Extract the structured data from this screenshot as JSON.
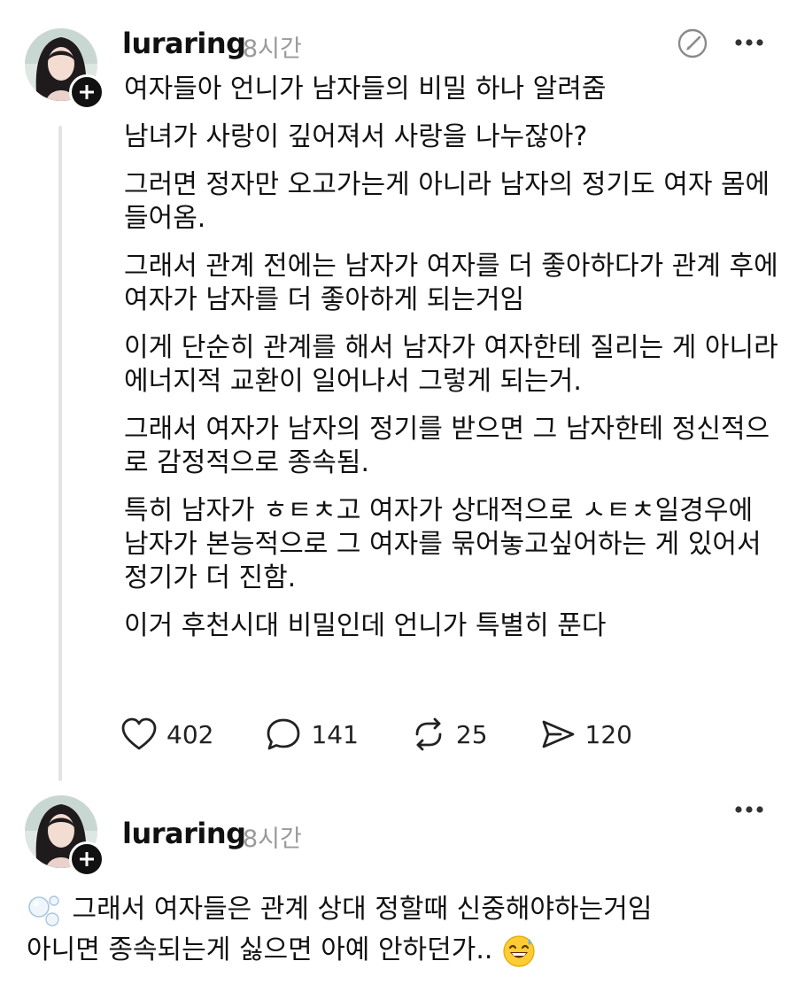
{
  "posts": [
    {
      "username": "luraring",
      "time": "8시간",
      "body": [
        "여자들아 언니가 남자들의 비밀 하나 알려줌",
        "남녀가 사랑이 깊어져서 사랑을 나누잖아?",
        "그러면 정자만 오고가는게 아니라 남자의 정기도 여자 몸에 들어옴.",
        "그래서 관계 전에는 남자가 여자를 더 좋아하다가 관계 후에 여자가 남자를 더 좋아하게 되는거임",
        "이게 단순히 관계를 해서 남자가 여자한테 질리는 게 아니라 에너지적 교환이 일어나서 그렇게 되는거.",
        "그래서 여자가 남자의 정기를 받으면 그 남자한테 정신적으로 감정적으로 종속됨.",
        "특히 남자가 ㅎㅌㅊ고 여자가 상대적으로 ㅅㅌㅊ일경우에 남자가 본능적으로 그 여자를 묶어놓고싶어하는 게 있어서 정기가 더 진함.",
        "이거 후천시대 비밀인데 언니가 특별히 푼다"
      ],
      "stats": {
        "likes": "402",
        "comments": "141",
        "reposts": "25",
        "shares": "120"
      },
      "icons": [
        "heart-icon",
        "comment-icon",
        "repost-icon",
        "share-icon",
        "compose-icon",
        "more-icon",
        "plus-icon"
      ]
    },
    {
      "username": "luraring",
      "time": "8시간",
      "body": [
        "그래서 여자들은 관계 상대 정할때 신중해야하는거임",
        "아니면 종속되는게 싫으면 아예 안하던가.."
      ],
      "icons": [
        "bubbles-icon",
        "sweat-smile-icon",
        "more-icon",
        "plus-icon"
      ]
    }
  ],
  "colors": {
    "text": "#111111",
    "muted": "#9a9a9a",
    "thread_line": "#e3e3e3"
  }
}
